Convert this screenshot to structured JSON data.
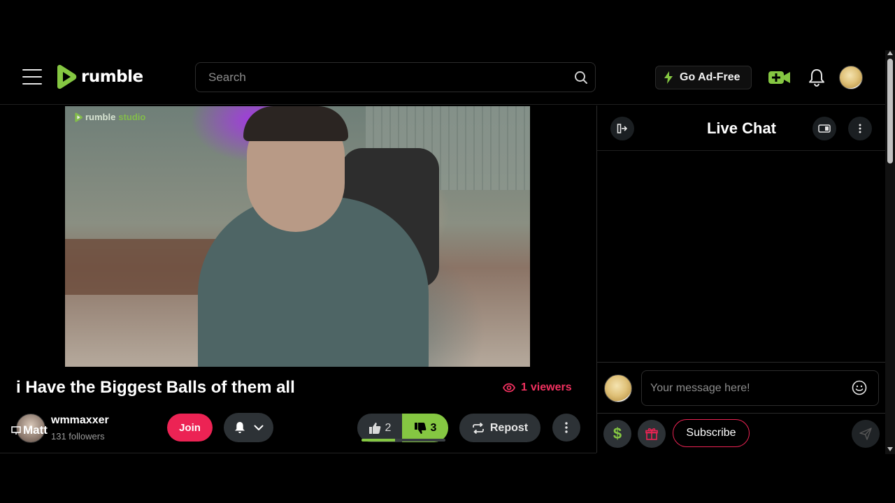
{
  "header": {
    "logo_text": "rumble",
    "search_placeholder": "Search",
    "ad_free_label": "Go Ad-Free"
  },
  "video": {
    "watermark_brand": "rumble",
    "watermark_sub": "studio"
  },
  "stream": {
    "title": "i Have the Biggest Balls of them all",
    "viewers_count": "1",
    "viewers_label": "viewers"
  },
  "channel": {
    "avatar_label": "Matt",
    "name": "wmmaxxer",
    "followers": "131 followers",
    "join_label": "Join"
  },
  "votes": {
    "upvotes": "2",
    "downvotes": "3",
    "up_ratio": 0.4
  },
  "actions": {
    "repost_label": "Repost"
  },
  "chat": {
    "title": "Live Chat",
    "input_placeholder": "Your message here!",
    "rant_symbol": "$",
    "subscribe_label": "Subscribe"
  },
  "colors": {
    "brand_green": "#85c742",
    "accent_red": "#ec2354",
    "live_red": "#f23160"
  }
}
